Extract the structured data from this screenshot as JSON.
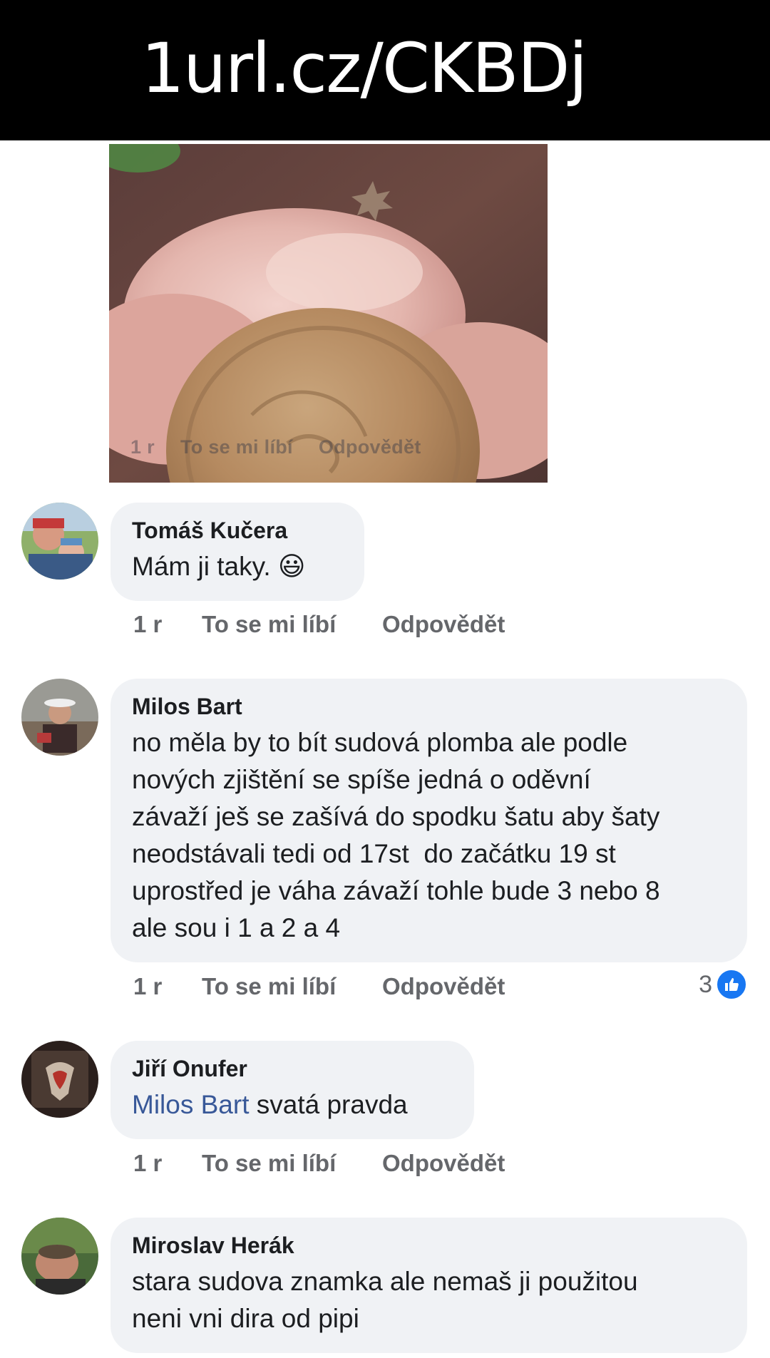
{
  "banner": {
    "url_text": "1url.cz/CKBDj"
  },
  "photo_overlay": {
    "age": "1 r",
    "like_label": "To se mi líbí",
    "reply_label": "Odpovědět"
  },
  "comments": [
    {
      "author": "Tomáš Kučera",
      "text": "Mám ji taky. 😃",
      "mention": "",
      "age": "1 r",
      "like_label": "To se mi líbí",
      "reply_label": "Odpovědět"
    },
    {
      "author": "Milos Bart",
      "text": "no měla by to bít sudová plomba ale podle\nnových zjištění se spíše jedná o oděvní\nzávaží ješ se zašívá do spodku šatu aby šaty\nneodstávali tedi od 17st  do začátku 19 st\nuprostřed je váha závaží tohle bude 3 nebo 8\nale sou i 1 a 2 a 4",
      "mention": "",
      "age": "1 r",
      "like_label": "To se mi líbí",
      "reply_label": "Odpovědět",
      "reaction_count": "3",
      "reaction_icon": "thumbs-up-icon"
    },
    {
      "author": "Jiří Onufer",
      "mention": "Milos Bart",
      "text": " svatá pravda",
      "age": "1 r",
      "like_label": "To se mi líbí",
      "reply_label": "Odpovědět"
    },
    {
      "author": "Miroslav Herák",
      "text": "stara sudova znamka ale nemaš ji použitou\nneni vni dira od pipi",
      "mention": ""
    }
  ],
  "colors": {
    "bubble_bg": "#f0f2f5",
    "meta_text": "#65676b",
    "mention": "#385898",
    "like_badge": "#1877f2"
  }
}
